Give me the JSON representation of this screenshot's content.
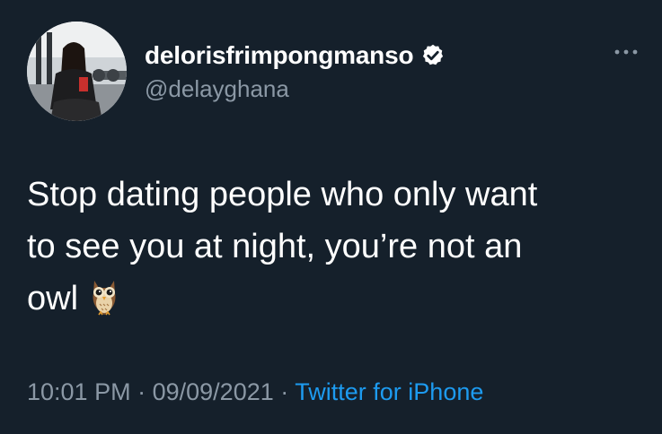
{
  "author": {
    "display_name": "delorisfrimpongmanso",
    "handle": "@delayghana",
    "verified_icon": "verified-badge-icon",
    "avatar": "avatar-photo"
  },
  "tweet": {
    "text": "Stop dating people who only want\nto see you at night, you’re not an\nowl",
    "emoji": "owl-emoji"
  },
  "meta": {
    "time": "10:01 PM",
    "separator": "·",
    "date": "09/09/2021",
    "source": "Twitter for iPhone"
  },
  "icons": {
    "more": "more-options-icon"
  },
  "colors": {
    "background": "#15202b",
    "text": "#ffffff",
    "secondary": "#8b98a5",
    "link": "#1d9bf0"
  }
}
